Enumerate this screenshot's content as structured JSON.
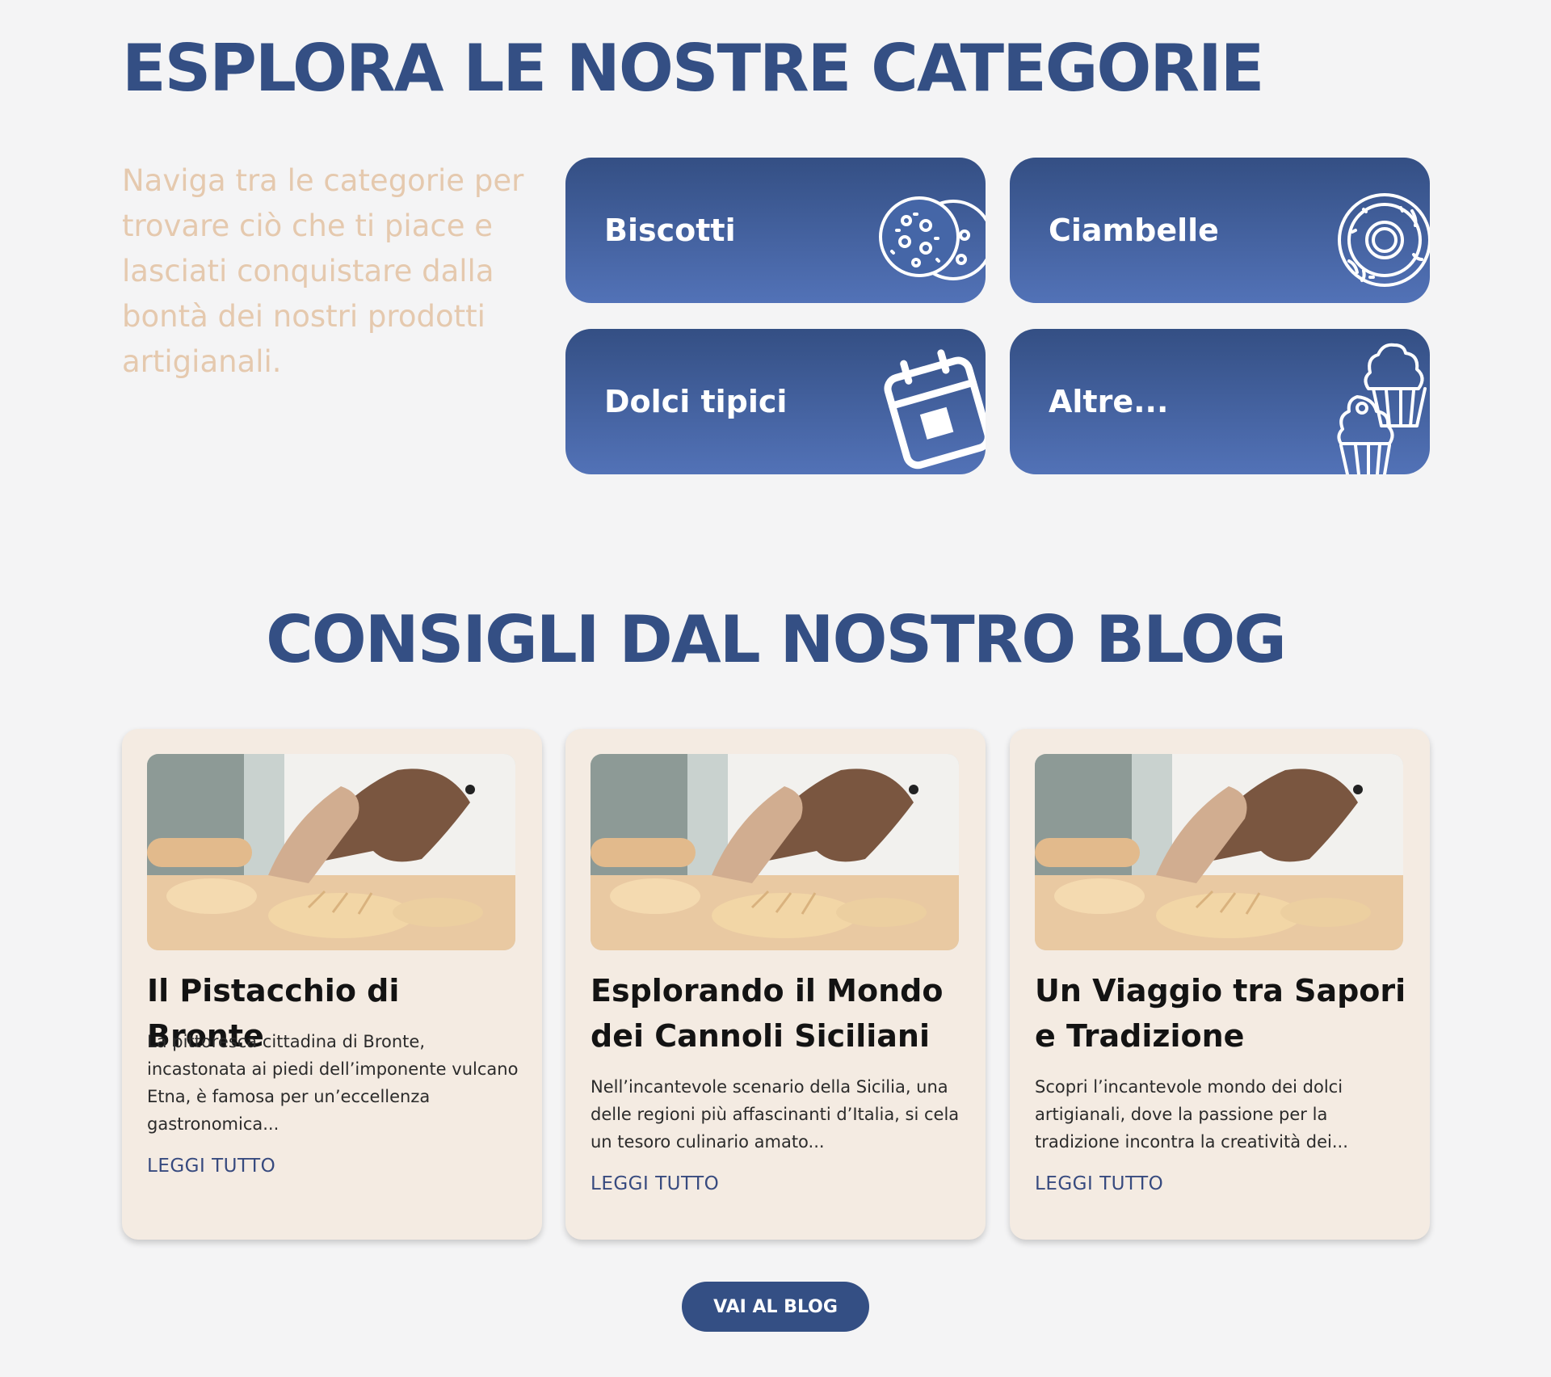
{
  "categories": {
    "title": "ESPLORA LE NOSTRE CATEGORIE",
    "intro": "Naviga tra le categorie per trovare ciò che ti piace e lasciati conquistare dalla bontà dei nostri prodotti artigianali.",
    "items": [
      {
        "label": "Biscotti",
        "icon": "cookie-icon"
      },
      {
        "label": "Ciambelle",
        "icon": "donut-icon"
      },
      {
        "label": "Dolci tipici",
        "icon": "calendar-icon"
      },
      {
        "label": "Altre...",
        "icon": "cupcake-icon"
      }
    ]
  },
  "blog": {
    "title": "CONSIGLI DAL NOSTRO BLOG",
    "posts": [
      {
        "title": "Il Pistacchio di Bronte",
        "excerpt": "La pittoresca cittadina di Bronte, incastonata ai piedi dell’imponente vulcano Etna, è famosa per un’eccellenza gastronomica...",
        "read_more": "LEGGI TUTTO"
      },
      {
        "title": "Esplorando il Mondo dei Cannoli Siciliani",
        "excerpt": "Nell’incantevole scenario della Sicilia, una delle regioni più affascinanti d’Italia, si cela un tesoro culinario amato...",
        "read_more": "LEGGI TUTTO"
      },
      {
        "title": "Un Viaggio tra Sapori e Tradizione",
        "excerpt": "Scopri l’incantevole mondo dei dolci artigianali, dove la passione per la tradizione incontra la creatività dei...",
        "read_more": "LEGGI TUTTO"
      }
    ],
    "button_label": "VAI AL BLOG"
  },
  "colors": {
    "primary_blue": "#344f84",
    "card_beige": "#f4ebe2",
    "intro_text": "#e5c9ae",
    "page_bg": "#f4f4f5"
  }
}
